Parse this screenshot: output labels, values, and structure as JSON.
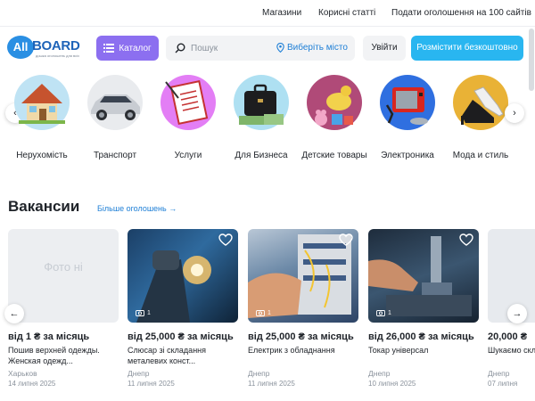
{
  "topbar": {
    "links": [
      "Магазини",
      "Корисні статті",
      "Подати оголошення на 100 сайтів"
    ]
  },
  "logo": {
    "all": "All",
    "board": "BOARD",
    "tagline": "дошка оголошень для всіх"
  },
  "header": {
    "catalog_label": "Каталог",
    "search_placeholder": "Пошук",
    "city_label": "Виберіть місто",
    "login_label": "Увійти",
    "post_label": "Розмістити безкоштовно"
  },
  "categories": [
    {
      "label": "Нерухомість",
      "icon": "house-icon"
    },
    {
      "label": "Транспорт",
      "icon": "car-icon"
    },
    {
      "label": "Услуги",
      "icon": "clipboard-icon"
    },
    {
      "label": "Для Бизнеса",
      "icon": "briefcase-icon"
    },
    {
      "label": "Детские товары",
      "icon": "toys-icon"
    },
    {
      "label": "Электроника",
      "icon": "electronics-icon"
    },
    {
      "label": "Мода и стиль",
      "icon": "shoes-icon"
    }
  ],
  "section": {
    "title": "Вакансии",
    "more_label": "Більше оголошень"
  },
  "listings": [
    {
      "price": "від 1 ₴ за місяць",
      "title": "Пошив верхней одежды. Женская одежд...",
      "location": "Харьков",
      "date": "14 липня 2025",
      "photo_placeholder": "Фото ні",
      "photo_count": ""
    },
    {
      "price": "від 25,000 ₴ за місяць",
      "title": "Слюсар зі складання металевих конст...",
      "location": "Днепр",
      "date": "11 липня 2025",
      "photo_placeholder": "",
      "photo_count": "1"
    },
    {
      "price": "від 25,000 ₴ за місяць",
      "title": "Електрик з обладнання",
      "location": "Днепр",
      "date": "11 липня 2025",
      "photo_placeholder": "",
      "photo_count": "1"
    },
    {
      "price": "від 26,000 ₴ за місяць",
      "title": "Токар універсал",
      "location": "Днепр",
      "date": "10 липня 2025",
      "photo_placeholder": "",
      "photo_count": "1"
    },
    {
      "price": "20,000 ₴",
      "title": "Шукаємо склад",
      "location": "Днепр",
      "date": "07 липня",
      "photo_placeholder": "",
      "photo_count": ""
    }
  ],
  "colors": {
    "accent_purple": "#8c6ff0",
    "accent_blue": "#29b6f0",
    "link_blue": "#1e7fd6"
  }
}
